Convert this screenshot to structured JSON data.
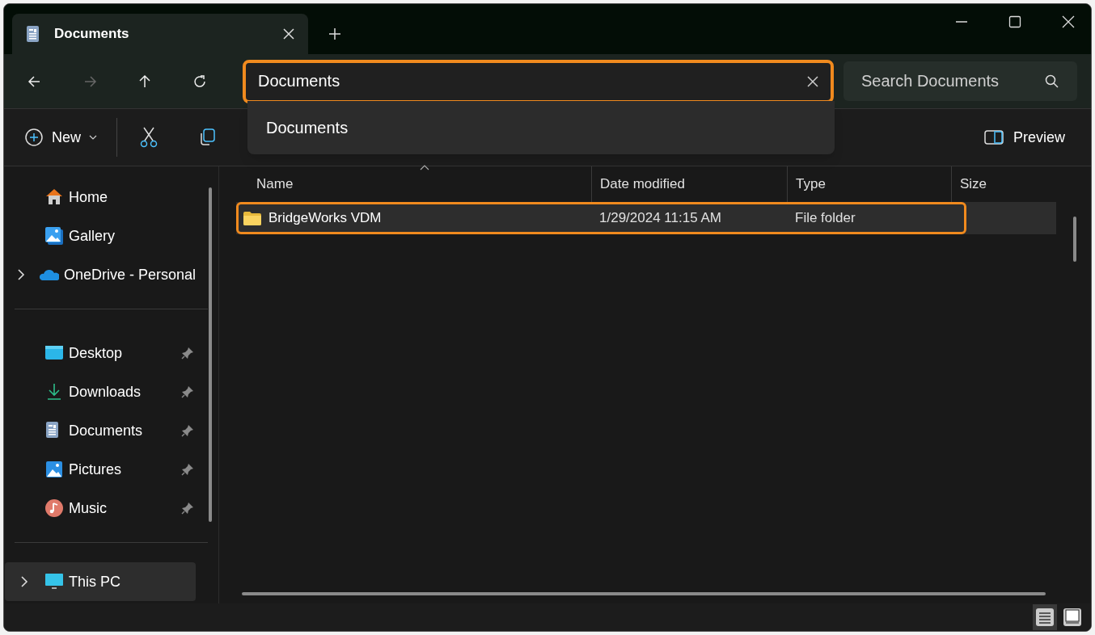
{
  "tab": {
    "title": "Documents",
    "selected": true
  },
  "address": {
    "value": "Documents",
    "highlighted": true
  },
  "address_suggestions": [
    "Documents"
  ],
  "search": {
    "placeholder": "Search Documents"
  },
  "toolbar": {
    "new_label": "New",
    "preview_label": "Preview"
  },
  "sidebar": {
    "groups": [
      [
        {
          "label": "Home",
          "pinned": false,
          "expandable": false,
          "selected": false
        },
        {
          "label": "Gallery",
          "pinned": false,
          "expandable": false,
          "selected": false
        },
        {
          "label": "OneDrive - Personal",
          "pinned": false,
          "expandable": true,
          "selected": false
        }
      ],
      [
        {
          "label": "Desktop",
          "pinned": true,
          "expandable": false,
          "selected": false
        },
        {
          "label": "Downloads",
          "pinned": true,
          "expandable": false,
          "selected": false
        },
        {
          "label": "Documents",
          "pinned": true,
          "expandable": false,
          "selected": false
        },
        {
          "label": "Pictures",
          "pinned": true,
          "expandable": false,
          "selected": false
        },
        {
          "label": "Music",
          "pinned": true,
          "expandable": false,
          "selected": false
        }
      ],
      [
        {
          "label": "This PC",
          "pinned": false,
          "expandable": true,
          "selected": true
        }
      ]
    ]
  },
  "table": {
    "columns": [
      "Name",
      "Date modified",
      "Type",
      "Size"
    ],
    "rows": [
      {
        "name": "BridgeWorks VDM",
        "date_modified": "1/29/2024 11:15 AM",
        "type": "File folder",
        "selected": true,
        "highlighted": true
      }
    ]
  },
  "status_bar": {
    "views": [
      {
        "selected": true
      },
      {
        "selected": false
      }
    ]
  }
}
